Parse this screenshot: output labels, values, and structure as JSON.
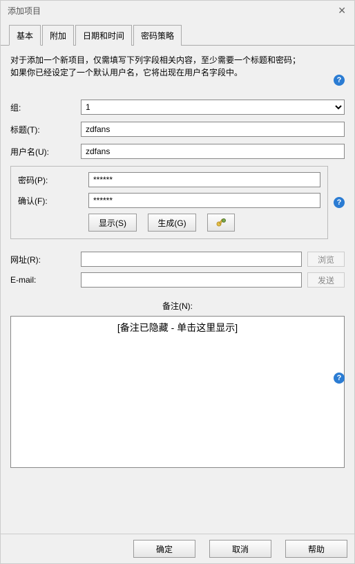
{
  "window": {
    "title": "添加项目"
  },
  "tabs": {
    "basic": "基本",
    "attach": "附加",
    "datetime": "日期和时间",
    "policy": "密码策略"
  },
  "intro": {
    "line1": "对于添加一个新项目，仅需填写下列字段相关内容，至少需要一个标题和密码；",
    "line2": "如果你已经设定了一个默认用户名，它将出现在用户名字段中。"
  },
  "labels": {
    "group": "组:",
    "title": "标题(T):",
    "username": "用户名(U):",
    "password": "密码(P):",
    "confirm": "确认(F):",
    "url": "网址(R):",
    "email": "E-mail:",
    "notes": "备注(N):"
  },
  "values": {
    "group": "1",
    "title": "zdfans",
    "username": "zdfans",
    "password": "******",
    "confirm": "******",
    "url": "",
    "email": "",
    "notes_hidden": "[备注已隐藏 - 单击这里显示]"
  },
  "buttons": {
    "show": "显示(S)",
    "generate": "生成(G)",
    "browse": "浏览",
    "send": "发送",
    "ok": "确定",
    "cancel": "取消",
    "help": "帮助"
  },
  "icons": {
    "generate_icon": "key-gear-icon",
    "help": "?"
  }
}
